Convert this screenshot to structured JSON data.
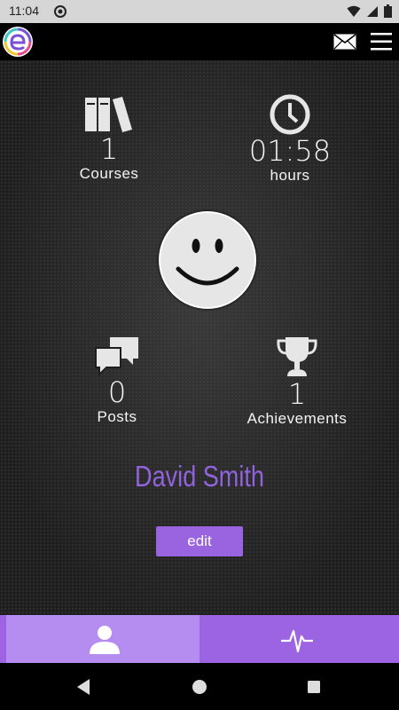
{
  "status_bar": {
    "time": "11:04"
  },
  "stats": [
    {
      "id": "courses",
      "value": "1",
      "label": "Courses",
      "icon": "books-icon"
    },
    {
      "id": "hours",
      "value": "01:58",
      "label": "hours",
      "icon": "clock-icon"
    },
    {
      "id": "posts",
      "value": "0",
      "label": "Posts",
      "icon": "chat-bubbles-icon"
    },
    {
      "id": "achievements",
      "value": "1",
      "label": "Achievements",
      "icon": "trophy-icon"
    }
  ],
  "profile": {
    "name": "David Smith",
    "edit_label": "edit"
  },
  "tabs": [
    {
      "id": "profile",
      "icon": "person-icon",
      "selected": true
    },
    {
      "id": "activity",
      "icon": "heartbeat-icon",
      "selected": false
    }
  ],
  "colors": {
    "accent": "#9a64e0",
    "tab_selected": "#b58cf0",
    "name": "#9163dc"
  }
}
